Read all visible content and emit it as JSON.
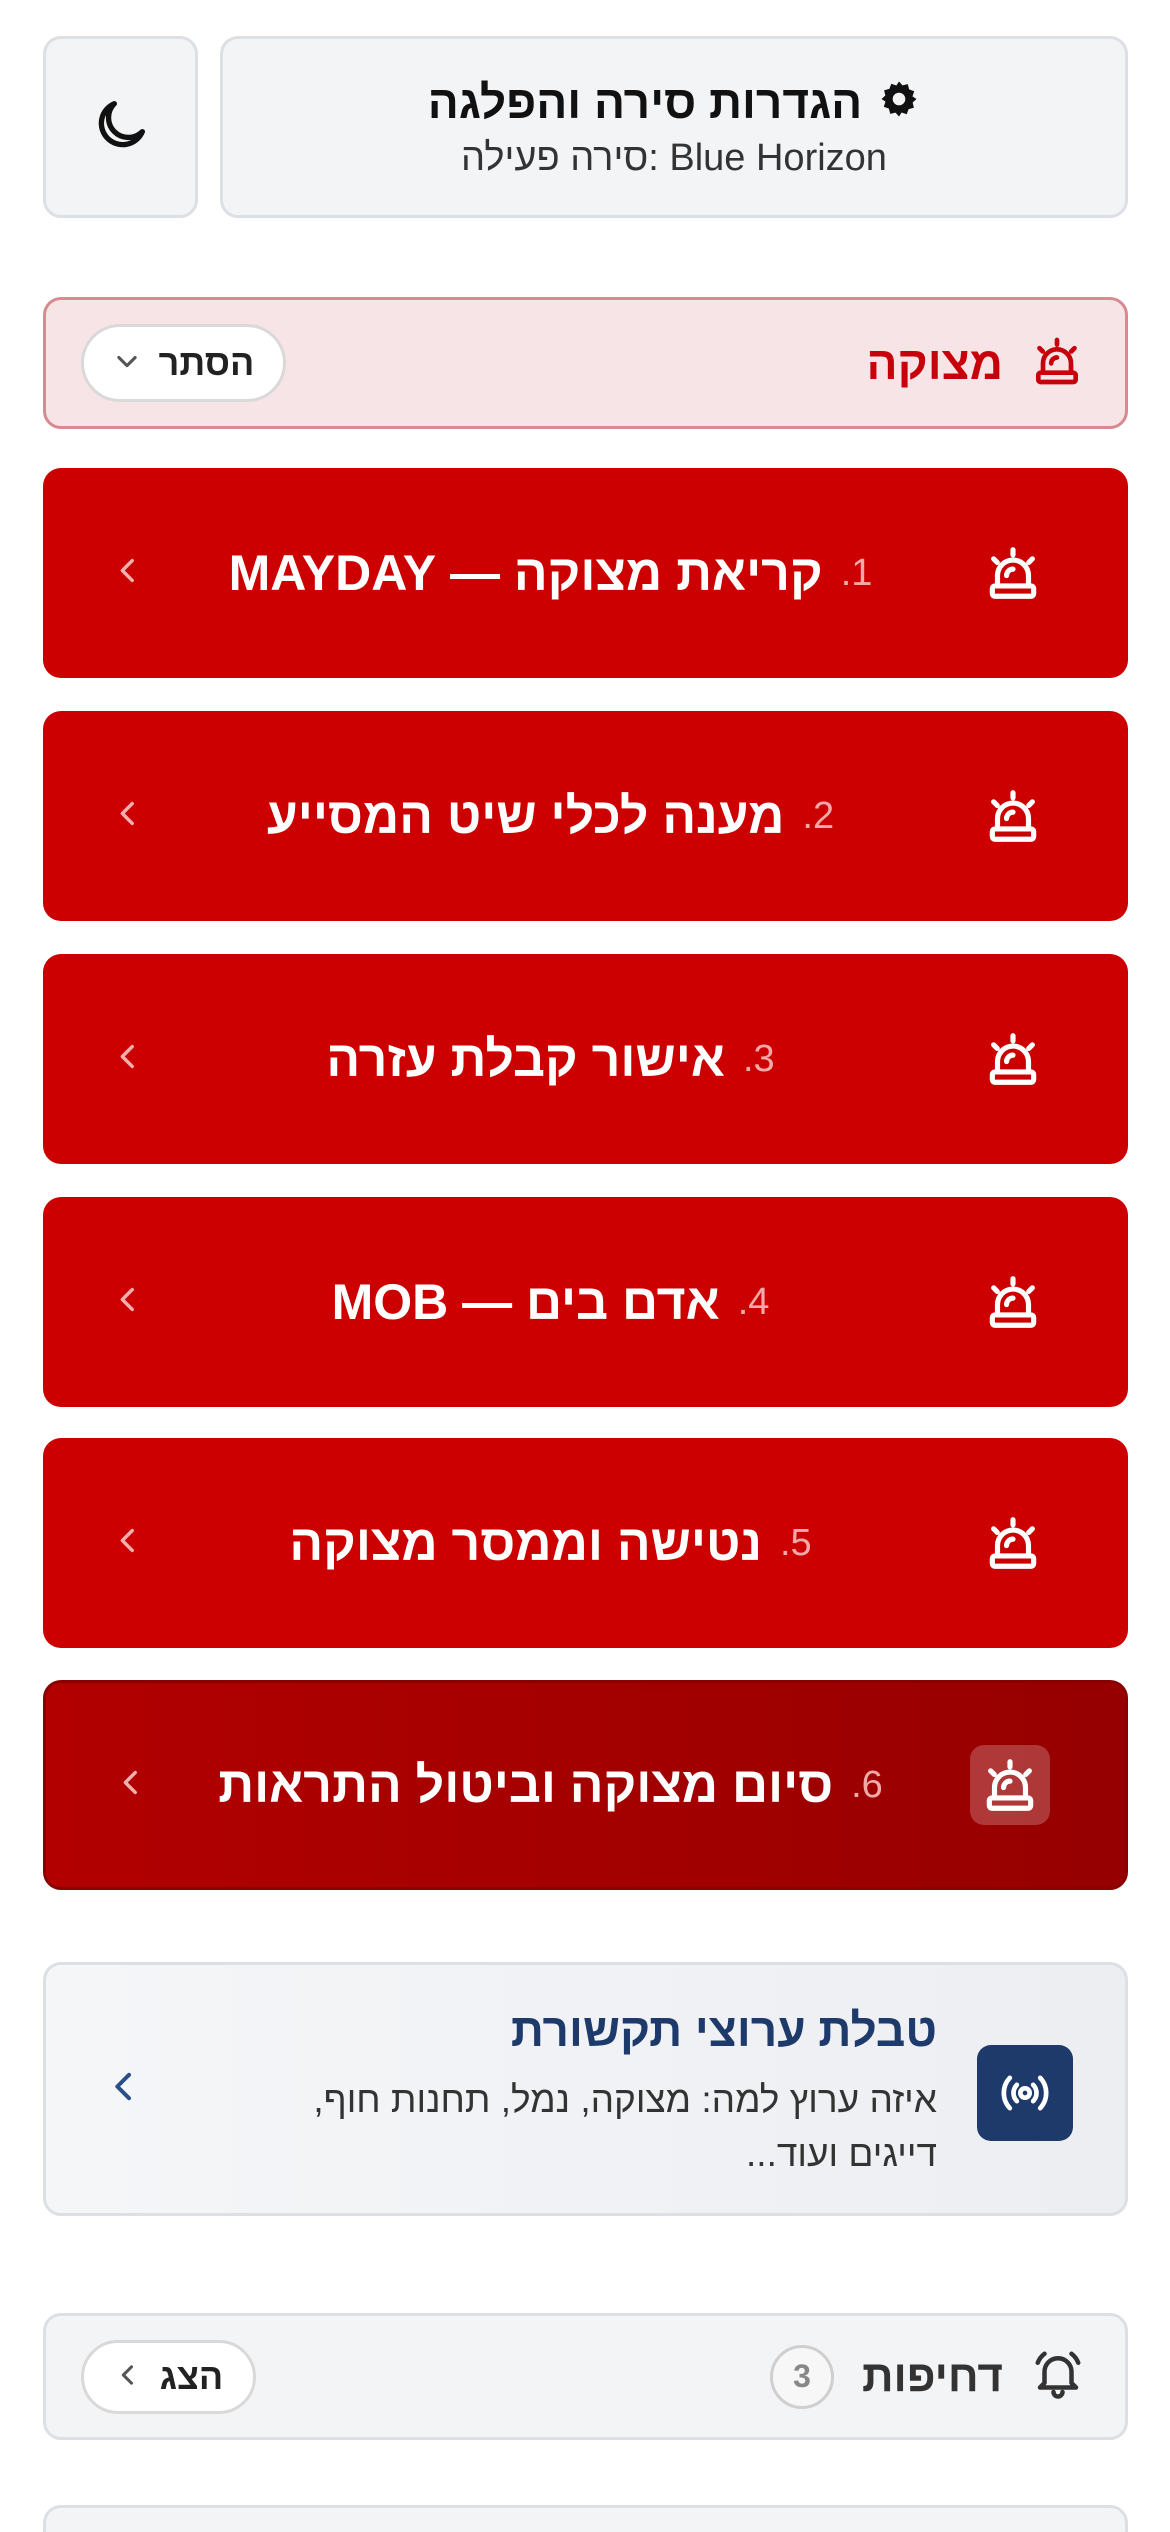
{
  "header": {
    "title": "הגדרות סירה והפלגה",
    "subtitle": "סירה פעילה: Blue Horizon"
  },
  "emergency": {
    "title": "מצוקה",
    "toggle_label": "הסתר",
    "items": [
      {
        "num": "1.",
        "label": "קריאת מצוקה — MAYDAY"
      },
      {
        "num": "2.",
        "label": "מענה לכלי שיט המסייע"
      },
      {
        "num": "3.",
        "label": "אישור קבלת עזרה"
      },
      {
        "num": "4.",
        "label": "אדם בים — MOB"
      },
      {
        "num": "5.",
        "label": "נטישה וממסר מצוקה"
      },
      {
        "num": "6.",
        "label": "סיום מצוקה וביטול התראות"
      }
    ]
  },
  "comm_table": {
    "title": "טבלת ערוצי תקשורת",
    "description": "איזה ערוץ למה: מצוקה, נמל, תחנות חוף, דייגים ועוד..."
  },
  "alerts": {
    "title": "דחיפות",
    "count": "3",
    "show_label": "הצג"
  },
  "colors": {
    "emergency_red": "#cc0000",
    "emergency_dark": "#960000",
    "navy": "#1d3a6b"
  },
  "icons": {
    "header": "gear-icon",
    "theme": "moon-icon",
    "emergency": "siren-icon",
    "comm": "broadcast-icon",
    "alerts": "bell-icon"
  }
}
